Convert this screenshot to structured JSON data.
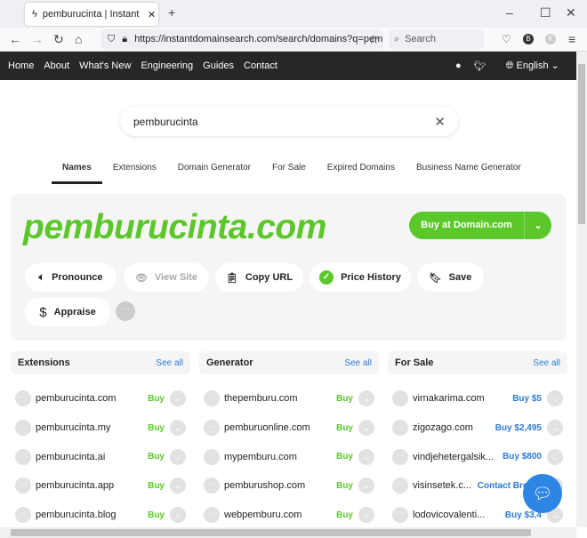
{
  "browser": {
    "tab_title": "pemburucinta | Instant Domain",
    "url": "https://instantdomainsearch.com/search/domains?q=pemburu",
    "search_placeholder": "Search",
    "profile_initial": "B",
    "profile2_initial": "K"
  },
  "nav": {
    "items": [
      "Home",
      "About",
      "What's New",
      "Engineering",
      "Guides",
      "Contact"
    ],
    "language": "English"
  },
  "search": {
    "value": "pemburucinta"
  },
  "tabs": [
    "Names",
    "Extensions",
    "Domain Generator",
    "For Sale",
    "Expired Domains",
    "Business Name Generator"
  ],
  "hero": {
    "domain": "pemburucinta.com",
    "buy_label": "Buy at Domain.com",
    "actions": [
      "Pronounce",
      "View Site",
      "Copy URL",
      "Price History",
      "Save",
      "Appraise"
    ]
  },
  "colors": {
    "green": "#5bc72b",
    "blue": "#2c7ad6"
  },
  "columns": [
    {
      "title": "Extensions",
      "see_all": "See all",
      "rows": [
        {
          "name": "pemburucinta.com",
          "action": "Buy"
        },
        {
          "name": "pemburucinta.my",
          "action": "Buy"
        },
        {
          "name": "pemburucinta.ai",
          "action": "Buy"
        },
        {
          "name": "pemburucinta.app",
          "action": "Buy"
        },
        {
          "name": "pemburucinta.blog",
          "action": "Buy"
        }
      ]
    },
    {
      "title": "Generator",
      "see_all": "See all",
      "rows": [
        {
          "name": "thepemburu.com",
          "action": "Buy"
        },
        {
          "name": "pemburuonline.com",
          "action": "Buy"
        },
        {
          "name": "mypemburu.com",
          "action": "Buy"
        },
        {
          "name": "pemburushop.com",
          "action": "Buy"
        },
        {
          "name": "webpemburu.com",
          "action": "Buy"
        }
      ]
    },
    {
      "title": "For Sale",
      "see_all": "See all",
      "rows": [
        {
          "name": "virnakarima.com",
          "action": "Buy $5"
        },
        {
          "name": "zigozago.com",
          "action": "Buy $2,495"
        },
        {
          "name": "vindjehetergalsik...",
          "action": "Buy $800"
        },
        {
          "name": "visinsetek.c...",
          "action": "Contact Broker"
        },
        {
          "name": "lodovicovalenti...",
          "action": "Buy $3,4"
        }
      ]
    }
  ]
}
